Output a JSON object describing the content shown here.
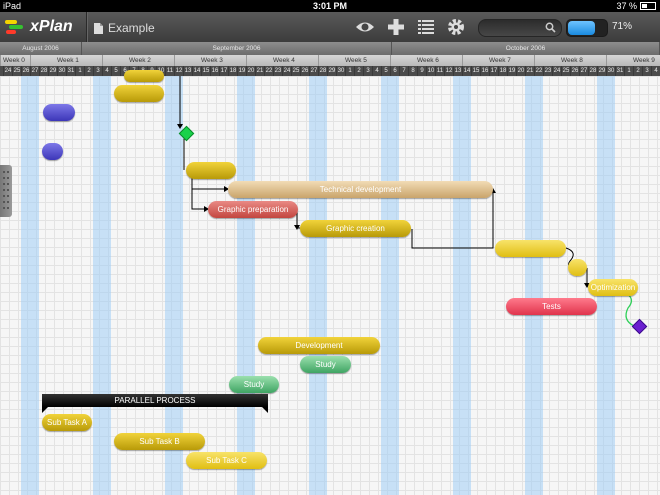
{
  "status_bar": {
    "device": "iPad",
    "time": "3:01 PM",
    "battery": "37 %"
  },
  "app": {
    "name": "xPlan",
    "document": "Example"
  },
  "toolbar": {
    "icons": [
      "eye-icon",
      "plus-icon",
      "list-icon",
      "gear-icon",
      "search-icon"
    ],
    "progress_value": 0.71,
    "progress_label": "71%"
  },
  "timeline": {
    "months": [
      "August 2006",
      "September 2006",
      "October 2006"
    ],
    "weeks": [
      "Week 0",
      "Week 1",
      "Week 2",
      "Week 3",
      "Week 4",
      "Week 5",
      "Week 6",
      "Week 7",
      "Week 8",
      "Week 9"
    ],
    "days": [
      "24",
      "25",
      "26",
      "27",
      "28",
      "29",
      "30",
      "31",
      "1",
      "2",
      "3",
      "4",
      "5",
      "6",
      "7",
      "8",
      "9",
      "10",
      "11",
      "12",
      "13",
      "14",
      "15",
      "16",
      "17",
      "18",
      "19",
      "20",
      "21",
      "22",
      "23",
      "24",
      "25",
      "26",
      "27",
      "28",
      "29",
      "30",
      "1",
      "2",
      "3",
      "4",
      "5",
      "6",
      "7",
      "8",
      "9",
      "10",
      "11",
      "12",
      "13",
      "14",
      "15",
      "16",
      "17",
      "18",
      "19",
      "20",
      "21",
      "22",
      "23",
      "24",
      "25",
      "26",
      "27",
      "28",
      "29",
      "30",
      "31",
      "1",
      "2",
      "3",
      "4"
    ]
  },
  "tasks": {
    "technical_development": "Technical development",
    "graphic_preparation": "Graphic preparation",
    "graphic_creation": "Graphic creation",
    "optimization": "Optimization",
    "tests": "Tests",
    "development": "Development",
    "study_a": "Study",
    "study_b": "Study",
    "parallel_process": "PARALLEL PROCESS",
    "sub_task_a": "Sub Task A",
    "sub_task_b": "Sub Task B",
    "sub_task_c": "Sub Task C"
  },
  "colors": {
    "gold": "#d4b41c",
    "red": "#c3463f",
    "pink": "#e0344c",
    "purple": "#3c36b8",
    "green": "#3fa463",
    "milestone_green": "#19d24a",
    "milestone_purple": "#6a1fd0",
    "weekend": "#a0cdf5"
  }
}
